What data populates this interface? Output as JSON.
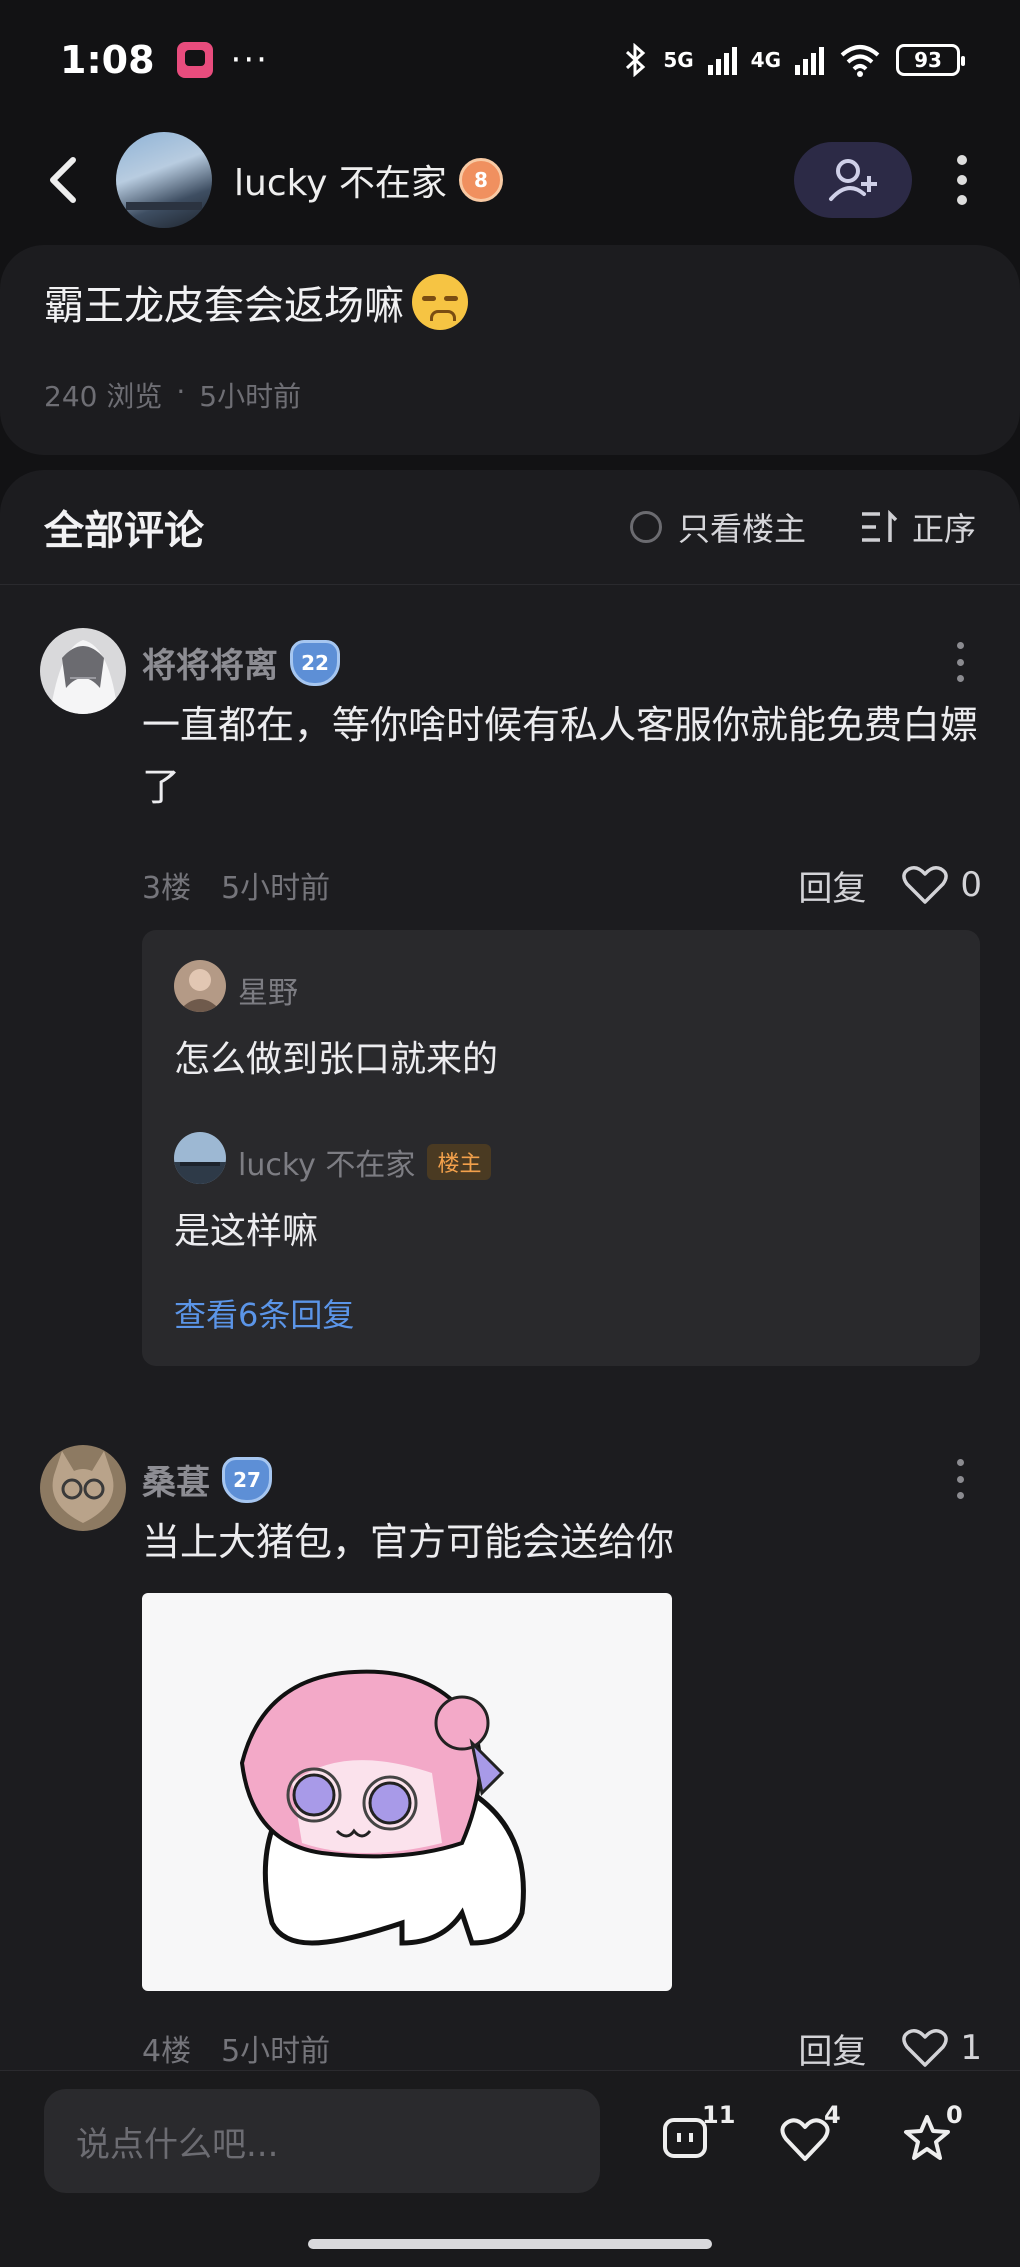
{
  "status_bar": {
    "time": "1:08",
    "dots": "···",
    "net_5g": "5G",
    "net_4g": "4G",
    "battery": "93"
  },
  "nav": {
    "username": "lucky 不在家",
    "level": "8"
  },
  "post": {
    "title": "霸王龙皮套会返场嘛",
    "views": "240 浏览",
    "separator": "·",
    "time": "5小时前"
  },
  "comments_header": {
    "title": "全部评论",
    "filter_owner": "只看楼主",
    "sort": "正序"
  },
  "comments": [
    {
      "name": "将将将离",
      "level": "22",
      "text": "一直都在，等你啥时候有私人客服你就能免费白嫖了",
      "floor": "3楼",
      "time": "5小时前",
      "reply": "回复",
      "likes": "0",
      "replies": [
        {
          "name": "星野",
          "text": "怎么做到张口就来的"
        },
        {
          "name": "lucky 不在家",
          "tag": "楼主",
          "text": "是这样嘛"
        }
      ],
      "view_replies": "查看6条回复"
    },
    {
      "name": "桑葚",
      "level": "27",
      "text": "当上大猪包，官方可能会送给你",
      "floor": "4楼",
      "time": "5小时前",
      "reply": "回复",
      "likes": "1"
    }
  ],
  "bottom_bar": {
    "input_placeholder": "说点什么吧...",
    "comments_count": "11",
    "likes_count": "4",
    "favorites_count": "0"
  },
  "colors": {
    "background": "#121214",
    "card": "#1c1c1f",
    "link": "#5b95e8",
    "owner_tag": "#f2a04b"
  }
}
